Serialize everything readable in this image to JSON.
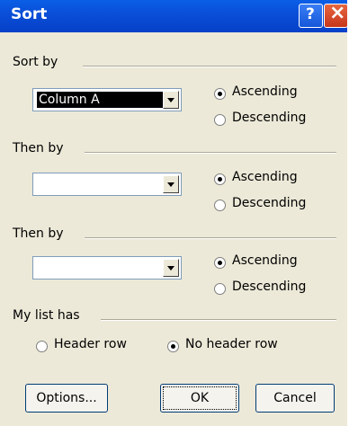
{
  "title": "Sort",
  "help_icon": "?",
  "close_icon": "×",
  "sort_by": {
    "label": "Sort by",
    "field_value": "Column A",
    "ascending": "Ascending",
    "descending": "Descending",
    "selected": "ascending"
  },
  "then_by_1": {
    "label": "Then by",
    "field_value": "",
    "ascending": "Ascending",
    "descending": "Descending",
    "selected": "ascending"
  },
  "then_by_2": {
    "label": "Then by",
    "field_value": "",
    "ascending": "Ascending",
    "descending": "Descending",
    "selected": "ascending"
  },
  "my_list_has": {
    "label": "My list has",
    "header_row": "Header row",
    "no_header_row": "No header row",
    "selected": "no_header_row"
  },
  "buttons": {
    "options": "Options...",
    "ok": "OK",
    "cancel": "Cancel"
  }
}
